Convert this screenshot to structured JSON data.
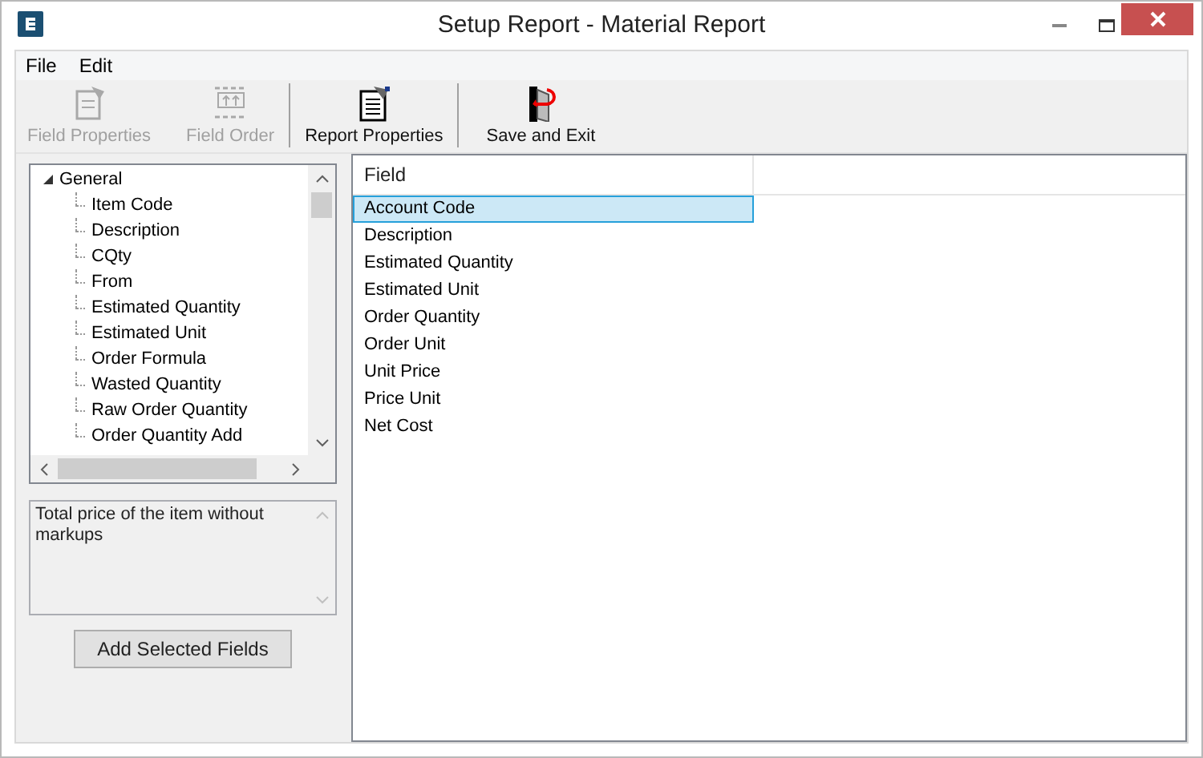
{
  "window": {
    "title": "Setup Report - Material Report"
  },
  "menu": [
    "File",
    "Edit"
  ],
  "toolbar": [
    {
      "label": "Field Properties",
      "kind": "field-properties",
      "disabled": true
    },
    {
      "label": "Field Order",
      "kind": "field-order",
      "disabled": true
    },
    {
      "label": "Report Properties",
      "kind": "report-properties",
      "disabled": false
    },
    {
      "label": "Save and Exit",
      "kind": "save-exit",
      "disabled": false
    }
  ],
  "tree": [
    {
      "label": "General",
      "expanded": true,
      "children": [
        {
          "label": "Item Code"
        },
        {
          "label": "Description"
        },
        {
          "label": "CQty"
        },
        {
          "label": "From"
        },
        {
          "label": "Estimated Quantity"
        },
        {
          "label": "Estimated Unit"
        },
        {
          "label": "Order Formula"
        },
        {
          "label": "Wasted Quantity"
        },
        {
          "label": "Raw Order Quantity"
        },
        {
          "label": "Order Quantity Add"
        }
      ]
    }
  ],
  "description": "Total price of the item without markups",
  "add_button": "Add Selected Fields",
  "fields": {
    "column": "Field",
    "rows": [
      {
        "label": "Account Code",
        "selected": true
      },
      {
        "label": "Description",
        "selected": false
      },
      {
        "label": "Estimated Quantity",
        "selected": false
      },
      {
        "label": "Estimated Unit",
        "selected": false
      },
      {
        "label": "Order Quantity",
        "selected": false
      },
      {
        "label": "Order Unit",
        "selected": false
      },
      {
        "label": "Unit Price",
        "selected": false
      },
      {
        "label": "Price Unit",
        "selected": false
      },
      {
        "label": "Net Cost",
        "selected": false
      }
    ]
  }
}
